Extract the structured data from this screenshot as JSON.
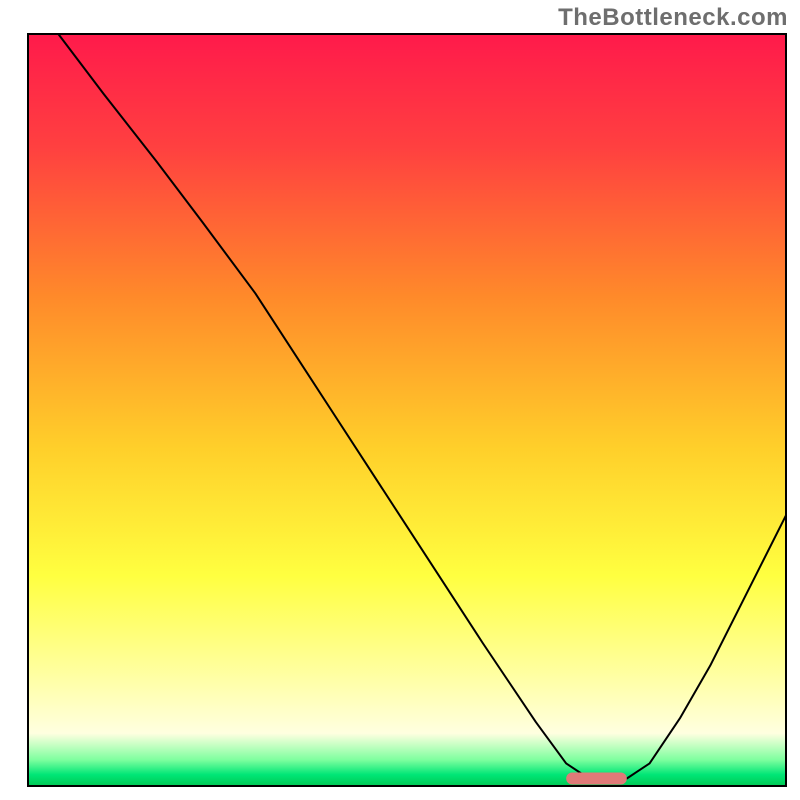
{
  "watermark": "TheBottleneck.com",
  "chart_data": {
    "type": "line",
    "title": "",
    "xlabel": "",
    "ylabel": "",
    "xlim": [
      0,
      100
    ],
    "ylim": [
      0,
      100
    ],
    "axes_visible": false,
    "grid": false,
    "legend": false,
    "background_gradient": {
      "type": "vertical",
      "stops": [
        {
          "pos": 0.0,
          "color": "#ff1a4b"
        },
        {
          "pos": 0.15,
          "color": "#ff4040"
        },
        {
          "pos": 0.35,
          "color": "#ff8a2a"
        },
        {
          "pos": 0.55,
          "color": "#ffcf2a"
        },
        {
          "pos": 0.72,
          "color": "#ffff40"
        },
        {
          "pos": 0.85,
          "color": "#ffffa0"
        },
        {
          "pos": 0.93,
          "color": "#ffffe0"
        },
        {
          "pos": 0.965,
          "color": "#7fff9f"
        },
        {
          "pos": 0.985,
          "color": "#00e676"
        },
        {
          "pos": 1.0,
          "color": "#00c853"
        }
      ]
    },
    "series": [
      {
        "name": "bottleneck-curve",
        "color": "#000000",
        "width": 2,
        "x": [
          4.0,
          10.0,
          17.0,
          23.0,
          30.0,
          40.0,
          50.0,
          60.0,
          67.0,
          71.0,
          74.0,
          79.0,
          82.0,
          86.0,
          90.0,
          94.0,
          97.0,
          100.0
        ],
        "y": [
          100.0,
          92.0,
          83.0,
          75.0,
          65.5,
          50.0,
          34.5,
          19.0,
          8.5,
          3.0,
          1.0,
          1.0,
          3.0,
          9.0,
          16.0,
          24.0,
          30.0,
          36.0
        ]
      }
    ],
    "markers": [
      {
        "name": "optimal-zone",
        "shape": "rounded-bar",
        "color": "#e07a78",
        "x_start": 71.0,
        "x_end": 79.0,
        "y": 1.0,
        "thickness_pct": 1.6
      }
    ],
    "frame": {
      "stroke": "#000000",
      "width": 2
    }
  }
}
